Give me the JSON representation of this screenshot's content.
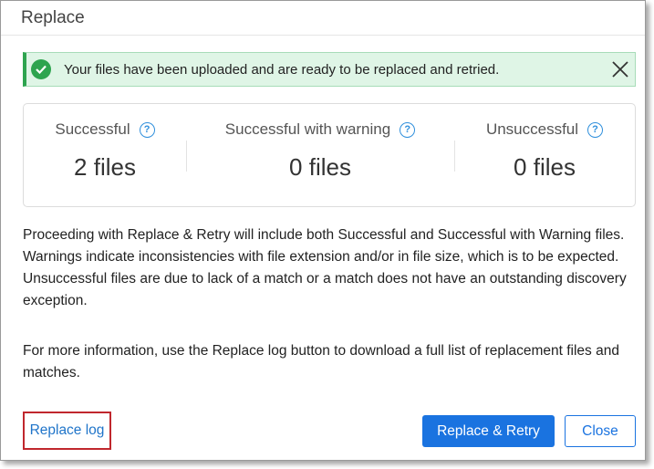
{
  "dialog": {
    "title": "Replace"
  },
  "banner": {
    "message": "Your files have been uploaded and are ready to be replaced and retried.",
    "status_color": "#2ea44f"
  },
  "stats": [
    {
      "label": "Successful",
      "value": "2 files"
    },
    {
      "label": "Successful with warning",
      "value": "0 files"
    },
    {
      "label": "Unsuccessful",
      "value": "0 files"
    }
  ],
  "help_glyph": "?",
  "body": {
    "paragraph1": "Proceeding with Replace & Retry will include both Successful and Successful with Warning files. Warnings indicate inconsistencies with file extension and/or in file size, which is to be expected. Unsuccessful files are due to lack of a match or a match does not have an outstanding discovery exception.",
    "paragraph2": "For more information, use the Replace log button to download a full list of replacement files and matches."
  },
  "footer": {
    "log_link": "Replace log",
    "primary_button": "Replace & Retry",
    "secondary_button": "Close",
    "accent_color": "#1a73e0"
  }
}
